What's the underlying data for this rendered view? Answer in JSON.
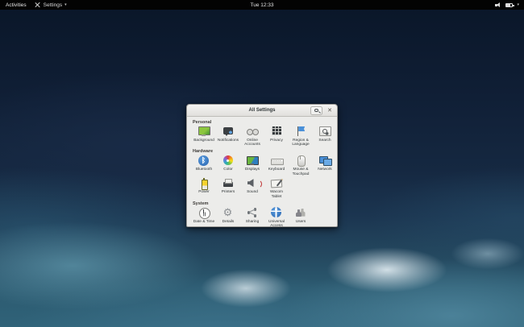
{
  "top_bar": {
    "activities_label": "Activities",
    "app_name": "Settings",
    "app_caret": "▾",
    "clock": "Tue 12:33",
    "status_icons": [
      "volume-icon",
      "battery-icon",
      "chevron-down-icon"
    ],
    "chevron": "▾"
  },
  "window": {
    "title": "All Settings",
    "close_label": "✕",
    "sections": [
      {
        "name": "Personal",
        "items": [
          {
            "label": "Background",
            "icon": "background-icon",
            "style": "i-background"
          },
          {
            "label": "Notifications",
            "icon": "notifications-icon",
            "style": "i-notifications"
          },
          {
            "label": "Online Accounts",
            "icon": "online-accounts-icon",
            "style": "i-online-accounts"
          },
          {
            "label": "Privacy",
            "icon": "privacy-icon",
            "style": "i-privacy"
          },
          {
            "label": "Region & Language",
            "icon": "region-language-icon",
            "style": "i-region-language"
          },
          {
            "label": "Search",
            "icon": "search-settings-icon",
            "style": "i-search-settings"
          }
        ]
      },
      {
        "name": "Hardware",
        "items": [
          {
            "label": "Bluetooth",
            "icon": "bluetooth-icon",
            "style": "i-bluetooth"
          },
          {
            "label": "Color",
            "icon": "color-icon",
            "style": "i-color"
          },
          {
            "label": "Displays",
            "icon": "displays-icon",
            "style": "i-displays"
          },
          {
            "label": "Keyboard",
            "icon": "keyboard-icon",
            "style": "i-keyboard"
          },
          {
            "label": "Mouse & Touchpad",
            "icon": "mouse-touchpad-icon",
            "style": "i-mouse"
          },
          {
            "label": "Network",
            "icon": "network-icon",
            "style": "i-network"
          },
          {
            "label": "Power",
            "icon": "power-icon",
            "style": "i-power"
          },
          {
            "label": "Printers",
            "icon": "printers-icon",
            "style": "i-printers"
          },
          {
            "label": "Sound",
            "icon": "sound-icon",
            "style": "i-sound"
          },
          {
            "label": "Wacom Tablet",
            "icon": "wacom-tablet-icon",
            "style": "i-wacom"
          }
        ]
      },
      {
        "name": "System",
        "items": [
          {
            "label": "Date & Time",
            "icon": "date-time-icon",
            "style": "i-date-time"
          },
          {
            "label": "Details",
            "icon": "details-icon",
            "style": "i-details"
          },
          {
            "label": "Sharing",
            "icon": "sharing-icon",
            "style": "i-sharing"
          },
          {
            "label": "Universal Access",
            "icon": "universal-access-icon",
            "style": "i-universal-access"
          },
          {
            "label": "Users",
            "icon": "users-icon",
            "style": "i-users"
          }
        ]
      }
    ]
  },
  "colors": {
    "accent": "#4a90d9",
    "topbar_bg": "#030303",
    "titlebar_bg": "#e9e8e5",
    "window_bg": "#ececea",
    "wallpaper_top": "#0a1628",
    "wallpaper_bottom": "#306379"
  }
}
